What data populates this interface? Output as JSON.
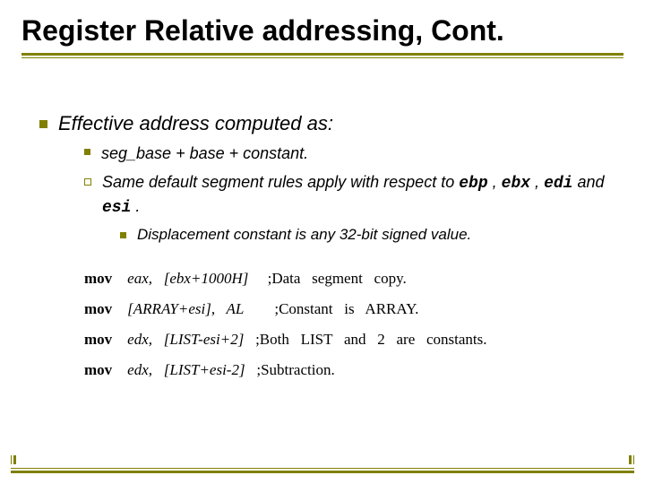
{
  "title": "Register Relative addressing, Cont.",
  "bullets": {
    "level1": {
      "text": "Effective address computed as:"
    },
    "level2a": {
      "text": "seg_base + base + constant."
    },
    "level2b": {
      "pre": "Same default segment rules apply with respect to ",
      "reg1": "ebp",
      "sep1": " , ",
      "reg2": "ebx",
      "sep2": " , ",
      "reg3": "edi",
      "and": " and ",
      "reg4": "esi",
      "post": " ."
    },
    "level3": {
      "text": "Displacement constant is any 32-bit signed value."
    }
  },
  "code": {
    "rows": [
      {
        "op": "mov",
        "args": "eax,   [ebx+1000H]",
        "comment": ";Data   segment   copy."
      },
      {
        "op": "mov",
        "args": "[ARRAY+esi],   AL",
        "comment": ";Constant   is   ARRAY."
      },
      {
        "op": "mov",
        "args": "edx,   [LIST-esi+2]",
        "comment": ";Both   LIST   and   2   are   constants."
      },
      {
        "op": "mov",
        "args": "edx,   [LIST+esi-2]",
        "comment": ";Subtraction."
      }
    ]
  }
}
